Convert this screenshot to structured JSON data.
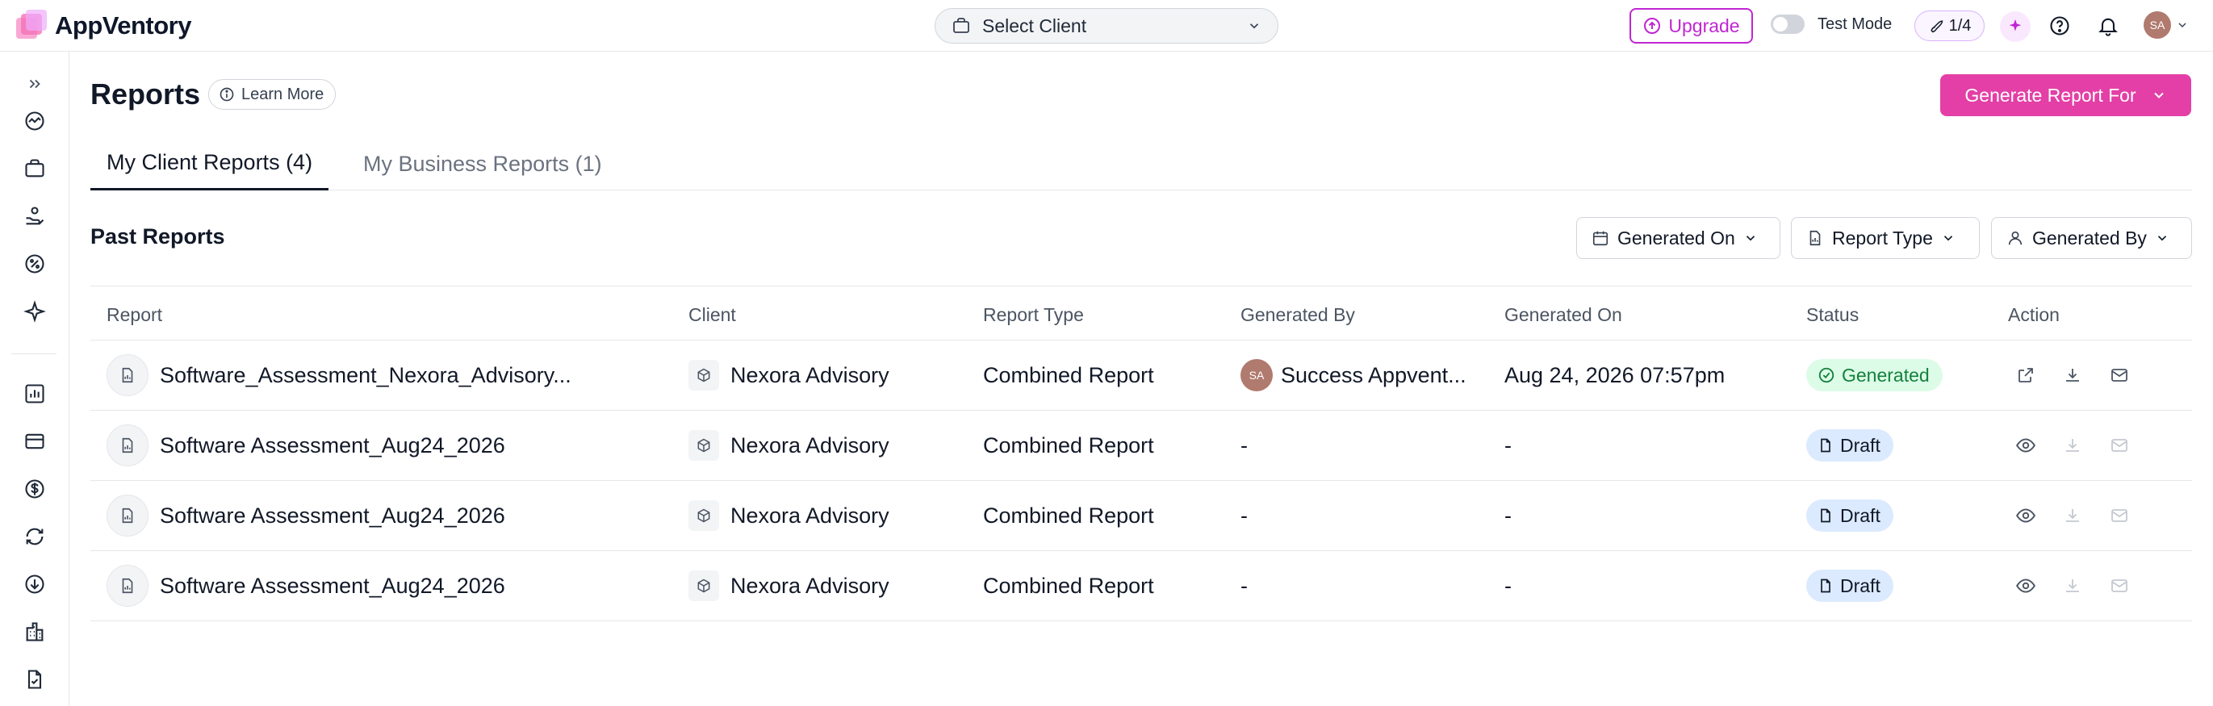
{
  "app": {
    "name": "AppVentory"
  },
  "header": {
    "client_select": "Select Client",
    "upgrade": "Upgrade",
    "test_mode": "Test Mode",
    "launch_progress": "1/4",
    "user_initials": "SA"
  },
  "page": {
    "title": "Reports",
    "learn_more": "Learn More",
    "generate_button": "Generate Report For"
  },
  "tabs": [
    {
      "label": "My Client Reports (4)",
      "active": true
    },
    {
      "label": "My Business Reports (1)",
      "active": false
    }
  ],
  "section": {
    "title": "Past Reports"
  },
  "filters": [
    {
      "label": "Generated On",
      "icon": "calendar-icon"
    },
    {
      "label": "Report Type",
      "icon": "report-icon"
    },
    {
      "label": "Generated By",
      "icon": "user-icon"
    }
  ],
  "table": {
    "columns": [
      "Report",
      "Client",
      "Report Type",
      "Generated By",
      "Generated On",
      "Status",
      "Action"
    ],
    "rows": [
      {
        "report": "Software_Assessment_Nexora_Advisory...",
        "client": "Nexora Advisory",
        "type": "Combined Report",
        "generated_by": "Success Appvent...",
        "generated_by_initials": "SA",
        "generated_on": "Aug 24, 2026 07:57pm",
        "status": "Generated"
      },
      {
        "report": "Software Assessment_Aug24_2026",
        "client": "Nexora Advisory",
        "type": "Combined Report",
        "generated_by": "-",
        "generated_on": "-",
        "status": "Draft"
      },
      {
        "report": "Software Assessment_Aug24_2026",
        "client": "Nexora Advisory",
        "type": "Combined Report",
        "generated_by": "-",
        "generated_on": "-",
        "status": "Draft"
      },
      {
        "report": "Software Assessment_Aug24_2026",
        "client": "Nexora Advisory",
        "type": "Combined Report",
        "generated_by": "-",
        "generated_on": "-",
        "status": "Draft"
      }
    ]
  },
  "colors": {
    "brand": "#e33fa6",
    "upgrade": "#c026d3",
    "generated": "#15803d",
    "draft_bg": "#dbeafe"
  },
  "sidebar_icons": [
    "expand-icon",
    "analytics-icon",
    "briefcase-icon",
    "vendor-hand-icon",
    "percent-icon",
    "sparkle-icon",
    "bar-chart-icon",
    "card-icon",
    "dollar-icon",
    "sync-icon",
    "download-circle-icon",
    "building-icon",
    "document-check-icon"
  ]
}
